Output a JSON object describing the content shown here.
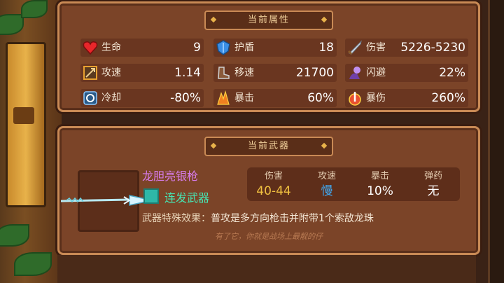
{
  "attributes": {
    "title": "当前属性",
    "stats": [
      {
        "icon": "heart-icon",
        "label": "生命",
        "value": "9",
        "color": "#e8262a"
      },
      {
        "icon": "shield-icon",
        "label": "护盾",
        "value": "18",
        "color": "#3a8ee6"
      },
      {
        "icon": "sword-icon",
        "label": "伤害",
        "value": "5226-5230",
        "color": "#c9d4e0"
      },
      {
        "icon": "attack-speed-icon",
        "label": "攻速",
        "value": "1.14",
        "color": "#e8a030"
      },
      {
        "icon": "boot-icon",
        "label": "移速",
        "value": "21700",
        "color": "#c0c0c0"
      },
      {
        "icon": "dodge-icon",
        "label": "闪避",
        "value": "22%",
        "color": "#a070d8"
      },
      {
        "icon": "cooldown-icon",
        "label": "冷却",
        "value": "-80%",
        "color": "#4aa8e8"
      },
      {
        "icon": "crit-icon",
        "label": "暴击",
        "value": "60%",
        "color": "#e87020"
      },
      {
        "icon": "crit-damage-icon",
        "label": "暴伤",
        "value": "260%",
        "color": "#e85030"
      }
    ]
  },
  "weapon": {
    "title": "当前武器",
    "name": "龙胆亮银枪",
    "type": "连发武器",
    "stats": [
      {
        "label": "伤害",
        "value": "40-44",
        "color": "#f0c040"
      },
      {
        "label": "攻速",
        "value": "慢",
        "color": "#40a8f0"
      },
      {
        "label": "暴击",
        "value": "10%",
        "color": "#ffffff"
      },
      {
        "label": "弹药",
        "value": "无",
        "color": "#ffffff"
      }
    ],
    "effect_label": "武器特殊效果：",
    "effect_text": "普攻是多方向枪击并附带1个索敌龙珠",
    "flavor": "有了它，你就是战场上最靓的仔"
  }
}
